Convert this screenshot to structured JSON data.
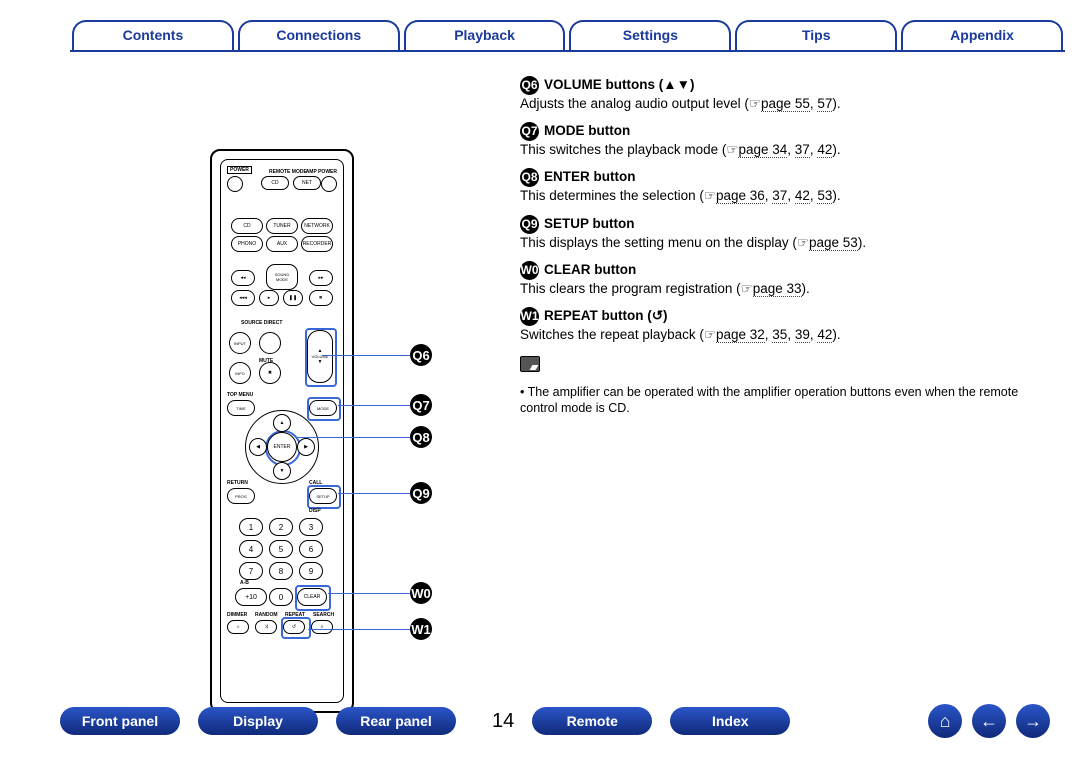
{
  "tabs": [
    "Contents",
    "Connections",
    "Playback",
    "Settings",
    "Tips",
    "Appendix"
  ],
  "items": [
    {
      "num": "16",
      "title": "VOLUME buttons (▲▼)",
      "desc_prefix": "Adjusts the analog audio output level (",
      "refs": [
        "page 55",
        "57"
      ],
      "desc_suffix": ")."
    },
    {
      "num": "17",
      "title": "MODE button",
      "desc_prefix": "This switches the playback mode (",
      "refs": [
        "page 34",
        "37",
        "42"
      ],
      "desc_suffix": ")."
    },
    {
      "num": "18",
      "title": "ENTER button",
      "desc_prefix": "This determines the selection (",
      "refs": [
        "page 36",
        "37",
        "42",
        "53"
      ],
      "desc_suffix": ")."
    },
    {
      "num": "19",
      "title": "SETUP button",
      "desc_prefix": "This displays the setting menu on the display (",
      "refs": [
        "page 53"
      ],
      "desc_suffix": ")."
    },
    {
      "num": "20",
      "title": "CLEAR button",
      "desc_prefix": "This clears the program registration (",
      "refs": [
        "page 33"
      ],
      "desc_suffix": ")."
    },
    {
      "num": "21",
      "title": "REPEAT button (↺)",
      "desc_prefix": "Switches the repeat playback (",
      "refs": [
        "page 32",
        "35",
        "39",
        "42"
      ],
      "desc_suffix": ")."
    }
  ],
  "note": "The amplifier can be operated with the amplifier operation buttons even when the remote control mode is CD.",
  "pointer_icon": "☞",
  "page_number": "14",
  "bottom_nav": [
    "Front panel",
    "Display",
    "Rear panel"
  ],
  "bottom_nav2": [
    "Remote",
    "Index"
  ],
  "icons": {
    "home": "⌂",
    "prev": "←",
    "next": "→"
  },
  "callouts": {
    "16": "Q6",
    "17": "Q7",
    "18": "Q8",
    "19": "Q9",
    "20": "W0",
    "21": "W1"
  },
  "remote_labels": {
    "power": "POWER",
    "remote_mode": "REMOTE MODE",
    "amp_power": "AMP POWER",
    "cd": "CD",
    "net": "NET",
    "tuner": "TUNER",
    "network": "NETWORK",
    "phono": "PHONO",
    "aux": "AUX",
    "recorder": "RECORDER",
    "sound_mode": "SOUND\nMODE",
    "source": "SOURCE DIRECT",
    "input": "INPUT",
    "mute": "MUTE",
    "info": "INFO",
    "volume": "VOLUME",
    "time": "TIME",
    "mode": "MODE",
    "enter": "ENTER",
    "topmenu": "TOP MENU",
    "prog": "PROG",
    "call": "CALL",
    "setup": "SETUP",
    "disp": "DISP",
    "return": "RETURN",
    "clear": "CLEAR",
    "plus10": "+10",
    "dimmer": "DIMMER",
    "random": "RANDOM",
    "repeat": "REPEAT",
    "search": "SEARCH"
  }
}
